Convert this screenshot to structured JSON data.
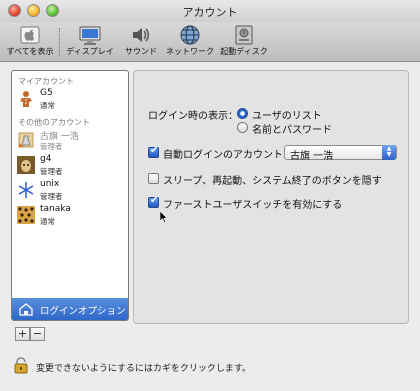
{
  "window": {
    "title": "アカウント"
  },
  "toolbar": {
    "items": [
      {
        "label": "すべてを表示",
        "icon": "apple-grid-icon"
      },
      {
        "label": "ディスプレイ",
        "icon": "display-icon"
      },
      {
        "label": "サウンド",
        "icon": "speaker-icon"
      },
      {
        "label": "ネットワーク",
        "icon": "network-globe-icon"
      },
      {
        "label": "起動ディスク",
        "icon": "startup-disk-icon"
      }
    ]
  },
  "sidebar": {
    "my_account_header": "マイアカウント",
    "other_accounts_header": "その他のアカウント",
    "my_account": {
      "name": "G5",
      "role": "通常"
    },
    "others": [
      {
        "name": "古旗 一浩",
        "role": "管理者",
        "disabled": true
      },
      {
        "name": "g4",
        "role": "管理者"
      },
      {
        "name": "unix",
        "role": "管理者"
      },
      {
        "name": "tanaka",
        "role": "通常"
      }
    ],
    "login_options_label": "ログインオプション",
    "add_label": "+",
    "remove_label": "−"
  },
  "panel": {
    "display_label": "ログイン時の表示：",
    "radio_users": "ユーザのリスト",
    "radio_name_pass": "名前とパスワード",
    "auto_login_label": "自動ログインのアカウント：",
    "auto_login_value": "古旗 一浩",
    "hide_buttons_label": "スリープ、再起動、システム終了のボタンを隠す",
    "fast_switch_label": "ファーストユーザスイッチを有効にする",
    "auto_login_checked": true,
    "hide_buttons_checked": false,
    "fast_switch_checked": true
  },
  "footer": {
    "lock_text": "変更できないようにするにはカギをクリックします。"
  },
  "colors": {
    "selection": "#2f67c9",
    "accent": "#2c6fd6"
  }
}
